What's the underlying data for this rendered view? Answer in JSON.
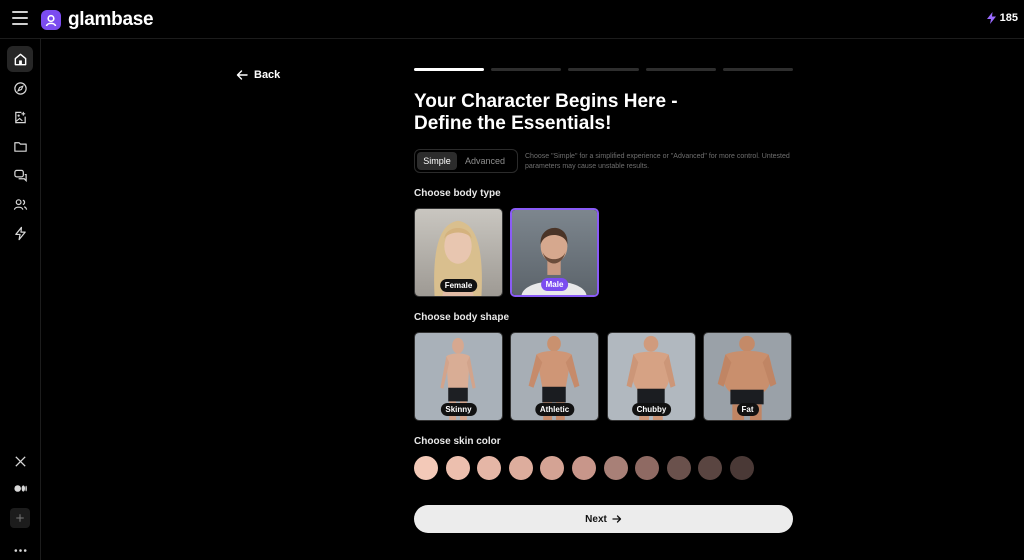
{
  "app": {
    "name": "glambase",
    "credits": "185"
  },
  "sidebar": {
    "items": [
      {
        "icon": "home-icon",
        "active": true
      },
      {
        "icon": "compass-icon",
        "active": false
      },
      {
        "icon": "image-edit-icon",
        "active": false
      },
      {
        "icon": "folder-icon",
        "active": false
      },
      {
        "icon": "chat-icon",
        "active": false
      },
      {
        "icon": "users-icon",
        "active": false
      },
      {
        "icon": "lightning-icon",
        "active": false
      }
    ],
    "bottom": [
      "x-social-icon",
      "medium-icon",
      "plus-icon",
      "more-icon"
    ]
  },
  "nav": {
    "back_label": "Back"
  },
  "progress": {
    "current": 1,
    "total": 5
  },
  "main": {
    "title": "Your Character Begins Here - Define the Essentials!",
    "mode": {
      "simple": "Simple",
      "advanced": "Advanced",
      "selected": "Simple"
    },
    "mode_hint": "Choose \"Simple\" for a simplified experience or \"Advanced\" for more control. Untested parameters may cause unstable results.",
    "body_type": {
      "label": "Choose body type",
      "options": [
        {
          "label": "Female",
          "selected": false
        },
        {
          "label": "Male",
          "selected": true
        }
      ]
    },
    "body_shape": {
      "label": "Choose body shape",
      "options": [
        {
          "label": "Skinny"
        },
        {
          "label": "Athletic"
        },
        {
          "label": "Chubby"
        },
        {
          "label": "Fat"
        }
      ]
    },
    "skin_color": {
      "label": "Choose skin color",
      "swatches": [
        "#f3c9b8",
        "#ecbfae",
        "#e5b6a6",
        "#ddad9d",
        "#d4a394",
        "#c8968a",
        "#a88077",
        "#8f6a63",
        "#6a514c",
        "#5a4541",
        "#4a3936"
      ]
    },
    "next_label": "Next"
  }
}
